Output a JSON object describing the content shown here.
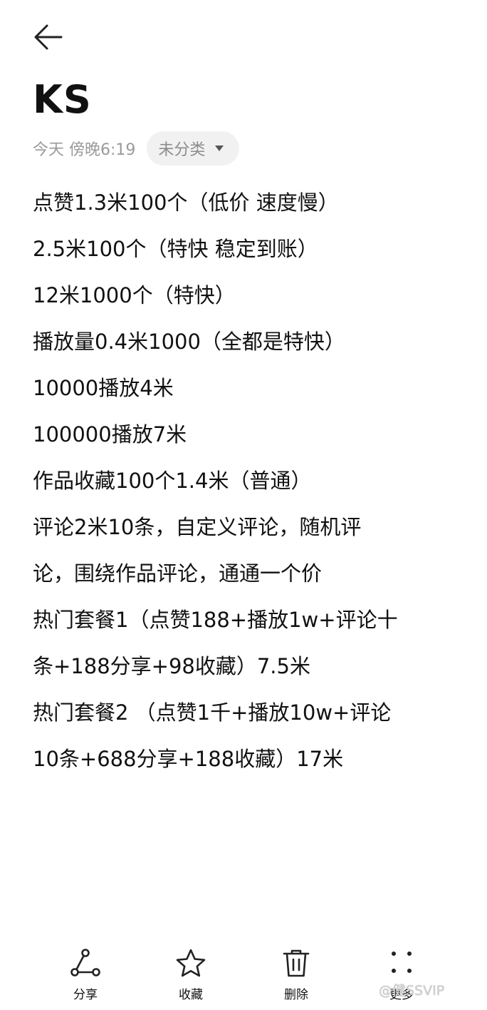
{
  "note": {
    "title": "KS",
    "date": "今天 傍晚6:19",
    "category": "未分类",
    "lines": [
      "点赞1.3米100个（低价 速度慢）",
      "2.5米100个（特快 稳定到账）",
      "12米1000个（特快）",
      "播放量0.4米1000（全都是特快）",
      "10000播放4米",
      "100000播放7米",
      "作品收藏100个1.4米（普通）",
      "评论2米10条，自定义评论，随机评",
      "论，围绕作品评论，通通一个价",
      "热门套餐1（点赞188+播放1w+评论十",
      "条+188分享+98收藏）7.5米",
      "热门套餐2 （点赞1千+播放10w+评论",
      "10条+688分享+188收藏）17米"
    ]
  },
  "toolbar": {
    "share_label": "分享",
    "favorite_label": "收藏",
    "delete_label": "删除",
    "more_label": "更多"
  },
  "icons": {
    "back": "arrow-left-icon",
    "share": "share-icon",
    "favorite": "star-icon",
    "delete": "trash-icon",
    "more": "more-dots-icon"
  },
  "watermark": "@健SSVIP"
}
